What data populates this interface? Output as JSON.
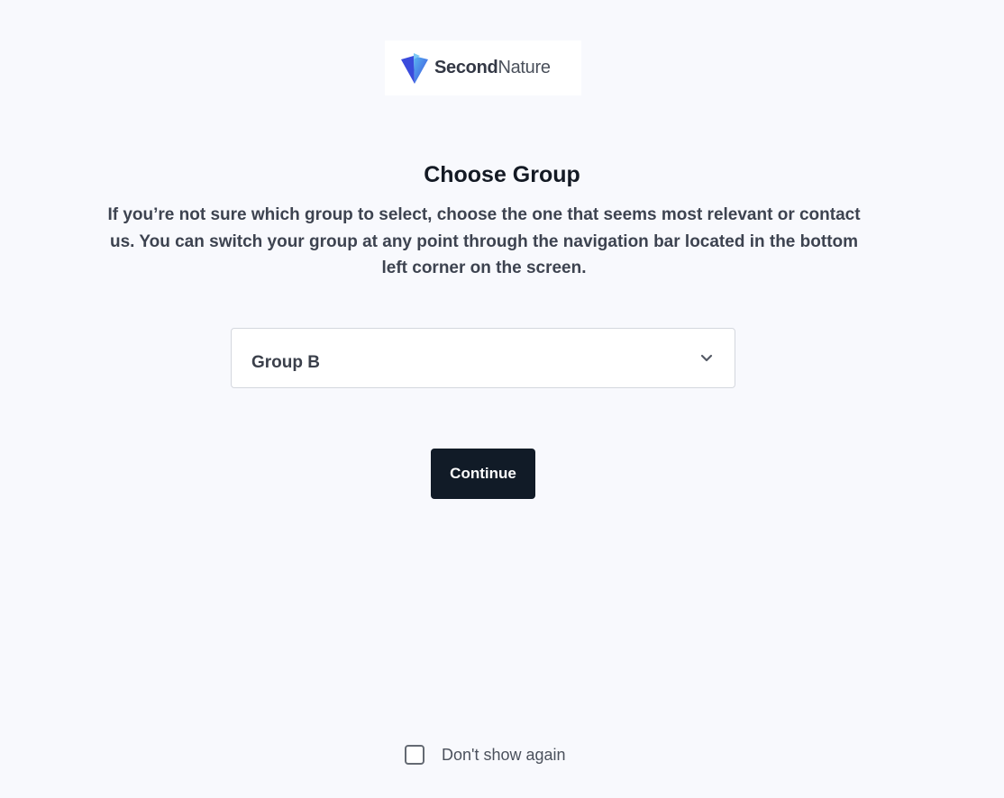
{
  "logo": {
    "icon": "secondnature-v-logo-icon",
    "brand_part1": "Second",
    "brand_part2": "Nature",
    "colors": {
      "primary": "#3a4bdc",
      "secondary": "#5ab8f2"
    }
  },
  "heading": {
    "title": "Choose Group",
    "description": "If you’re not sure which group to select, choose the one that seems most relevant or contact us. You can switch your group at any point through the navigation bar located in the bottom left corner on the screen."
  },
  "group_select": {
    "selected_value": "Group B",
    "icon": "chevron-down-icon"
  },
  "actions": {
    "continue_label": "Continue",
    "button_color": "#111b27"
  },
  "footer": {
    "dont_show_label": "Don't show again",
    "checked": false
  }
}
